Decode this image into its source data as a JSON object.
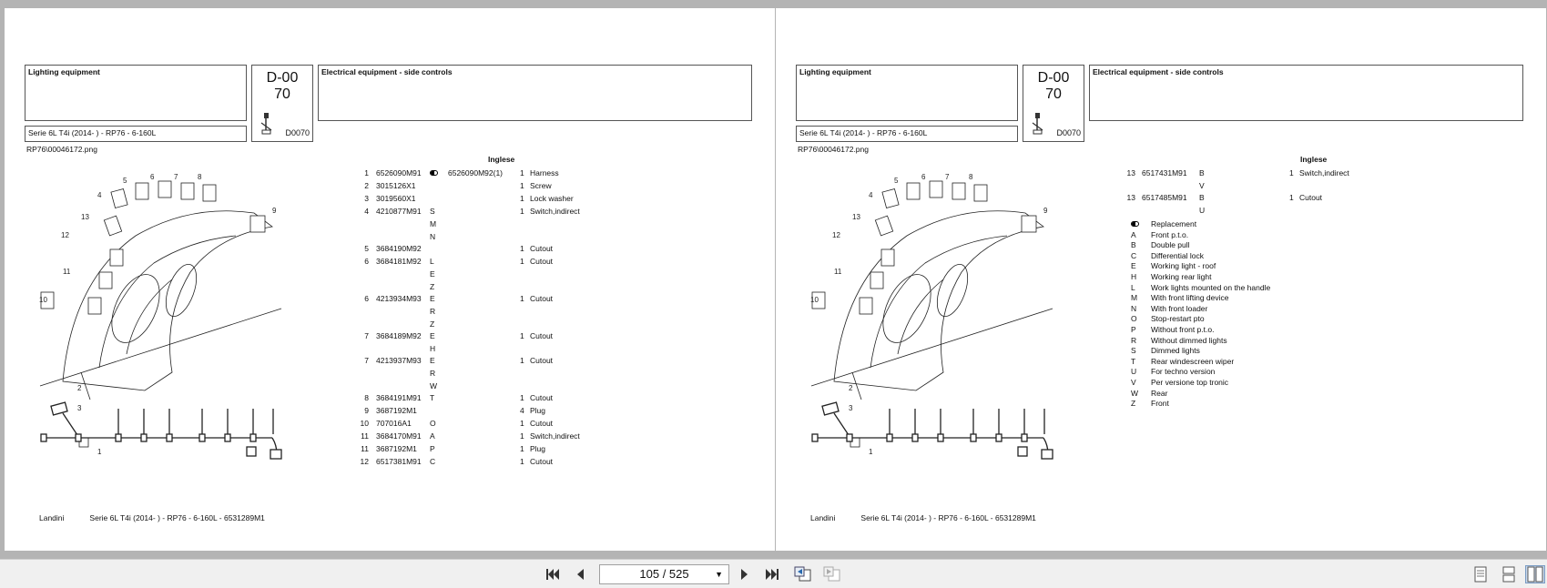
{
  "pages": [
    {
      "section_title": "Lighting equipment",
      "serie": "Serie 6L T4i (2014-    ) - RP76 - 6-160L",
      "code_main_1": "D-00",
      "code_main_2": "70",
      "code_small": "D0070",
      "description": "Electrical equipment - side controls",
      "image_name": "RP76\\00046172.png",
      "lang_header": "Inglese",
      "footer_brand": "Landini",
      "footer_text": "Serie 6L T4i (2014-    ) - RP76 - 6-160L - 6531289M1"
    },
    {
      "section_title": "Lighting equipment",
      "serie": "Serie 6L T4i (2014-    ) - RP76 - 6-160L",
      "code_main_1": "D-00",
      "code_main_2": "70",
      "code_small": "D0070",
      "description": "Electrical equipment - side controls",
      "image_name": "RP76\\00046172.png",
      "lang_header": "Inglese",
      "footer_brand": "Landini",
      "footer_text": "Serie 6L T4i (2014-    ) - RP76 - 6-160L - 6531289M1"
    }
  ],
  "parts_page1": [
    {
      "pos": "1",
      "part": "6526090M91",
      "repl": true,
      "repl_part": "6526090M92(1)",
      "codes": [],
      "qty": "1",
      "desc": "Harness"
    },
    {
      "pos": "2",
      "part": "3015126X1",
      "codes": [],
      "qty": "1",
      "desc": "Screw"
    },
    {
      "pos": "3",
      "part": "3019560X1",
      "codes": [],
      "qty": "1",
      "desc": "Lock washer"
    },
    {
      "pos": "4",
      "part": "4210877M91",
      "codes": [
        "S",
        "M",
        "N"
      ],
      "qty": "1",
      "desc": "Switch,indirect"
    },
    {
      "pos": "5",
      "part": "3684190M92",
      "codes": [],
      "qty": "1",
      "desc": "Cutout"
    },
    {
      "pos": "6",
      "part": "3684181M92",
      "codes": [
        "L",
        "E",
        "Z"
      ],
      "qty": "1",
      "desc": "Cutout"
    },
    {
      "pos": "6",
      "part": "4213934M93",
      "codes": [
        "E",
        "R",
        "Z"
      ],
      "qty": "1",
      "desc": "Cutout"
    },
    {
      "pos": "7",
      "part": "3684189M92",
      "codes": [
        "E",
        "H"
      ],
      "qty": "1",
      "desc": "Cutout"
    },
    {
      "pos": "7",
      "part": "4213937M93",
      "codes": [
        "E",
        "R",
        "W"
      ],
      "qty": "1",
      "desc": "Cutout"
    },
    {
      "pos": "8",
      "part": "3684191M91",
      "codes": [
        "T"
      ],
      "qty": "1",
      "desc": "Cutout"
    },
    {
      "pos": "9",
      "part": "3687192M1",
      "codes": [],
      "qty": "4",
      "desc": "Plug"
    },
    {
      "pos": "10",
      "part": "707016A1",
      "codes": [
        "O"
      ],
      "qty": "1",
      "desc": "Cutout"
    },
    {
      "pos": "11",
      "part": "3684170M91",
      "codes": [
        "A"
      ],
      "qty": "1",
      "desc": "Switch,indirect"
    },
    {
      "pos": "11",
      "part": "3687192M1",
      "codes": [
        "P"
      ],
      "qty": "1",
      "desc": "Plug"
    },
    {
      "pos": "12",
      "part": "6517381M91",
      "codes": [
        "C"
      ],
      "qty": "1",
      "desc": "Cutout"
    }
  ],
  "parts_page2": [
    {
      "pos": "13",
      "part": "6517431M91",
      "codes": [
        "B",
        "V"
      ],
      "qty": "1",
      "desc": "Switch,indirect"
    },
    {
      "pos": "13",
      "part": "6517485M91",
      "codes": [
        "B",
        "U"
      ],
      "qty": "1",
      "desc": "Cutout"
    }
  ],
  "legend": [
    {
      "k": "",
      "v": "Replacement",
      "icon": "replacement-icon"
    },
    {
      "k": "A",
      "v": "Front p.t.o."
    },
    {
      "k": "B",
      "v": "Double pull"
    },
    {
      "k": "C",
      "v": "Differential lock"
    },
    {
      "k": "E",
      "v": "Working light - roof"
    },
    {
      "k": "H",
      "v": "Working rear light"
    },
    {
      "k": "L",
      "v": "Work lights mounted on the handle"
    },
    {
      "k": "M",
      "v": "With front lifting device"
    },
    {
      "k": "N",
      "v": "With front loader"
    },
    {
      "k": "O",
      "v": "Stop-restart pto"
    },
    {
      "k": "P",
      "v": "Without front p.t.o."
    },
    {
      "k": "R",
      "v": "Without dimmed lights"
    },
    {
      "k": "S",
      "v": "Dimmed lights"
    },
    {
      "k": "T",
      "v": "Rear windescreen wiper"
    },
    {
      "k": "U",
      "v": "For techno version"
    },
    {
      "k": "V",
      "v": "Per versione top tronic"
    },
    {
      "k": "W",
      "v": "Rear"
    },
    {
      "k": "Z",
      "v": "Front"
    }
  ],
  "drawing_labels": [
    "1",
    "2",
    "3",
    "4",
    "5",
    "6",
    "7",
    "8",
    "9",
    "10",
    "11",
    "12",
    "13"
  ],
  "toolbar": {
    "page_indicator": "105 / 525",
    "icons": [
      "first-page-icon",
      "prev-page-icon",
      "next-page-icon",
      "last-page-icon",
      "back-view-icon",
      "forward-view-icon",
      "single-page-view-icon",
      "continuous-view-icon",
      "two-page-view-icon"
    ]
  }
}
